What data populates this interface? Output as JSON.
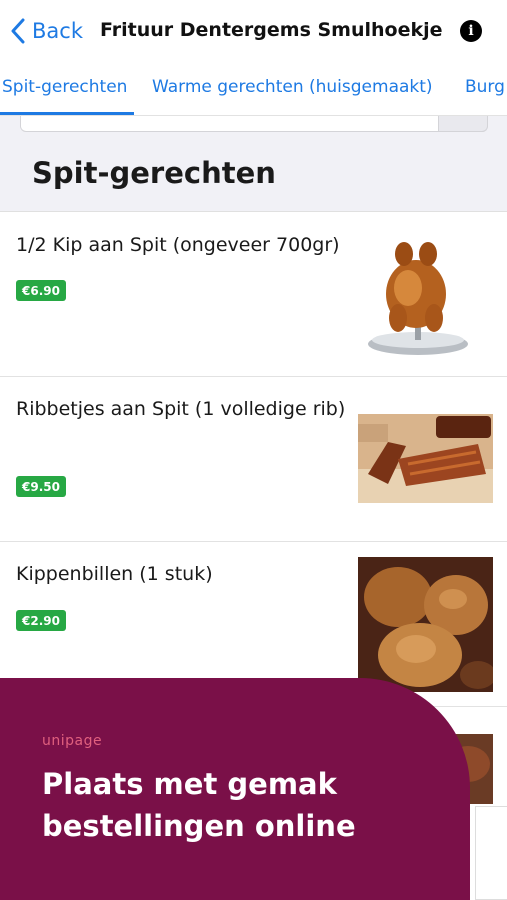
{
  "nav": {
    "back_label": "Back",
    "title": "Frituur Dentergems Smulhoekje",
    "info_glyph": "i"
  },
  "tabs": [
    {
      "label": "Spit-gerechten",
      "active": true
    },
    {
      "label": "Warme gerechten (huisgemaakt)",
      "active": false
    },
    {
      "label": "Burg",
      "active": false
    }
  ],
  "section": {
    "title": "Spit-gerechten"
  },
  "items": [
    {
      "name": "1/2 Kip aan Spit (ongeveer 700gr)",
      "price": "€6.90",
      "image": "roast-chicken-on-stand"
    },
    {
      "name": "Ribbetjes aan Spit (1 volledige rib)",
      "price": "€9.50",
      "image": "grilled-ribs"
    },
    {
      "name": "Kippenbillen (1 stuk)",
      "price": "€2.90",
      "image": "roasted-chicken-legs"
    }
  ],
  "promo": {
    "logo": "unipage",
    "headline": "Plaats met gemak bestellingen online"
  },
  "colors": {
    "accent": "#1e7ae3",
    "price_badge": "#27a844",
    "promo_bg": "#7a1048",
    "section_bg": "#f1f1f6"
  }
}
